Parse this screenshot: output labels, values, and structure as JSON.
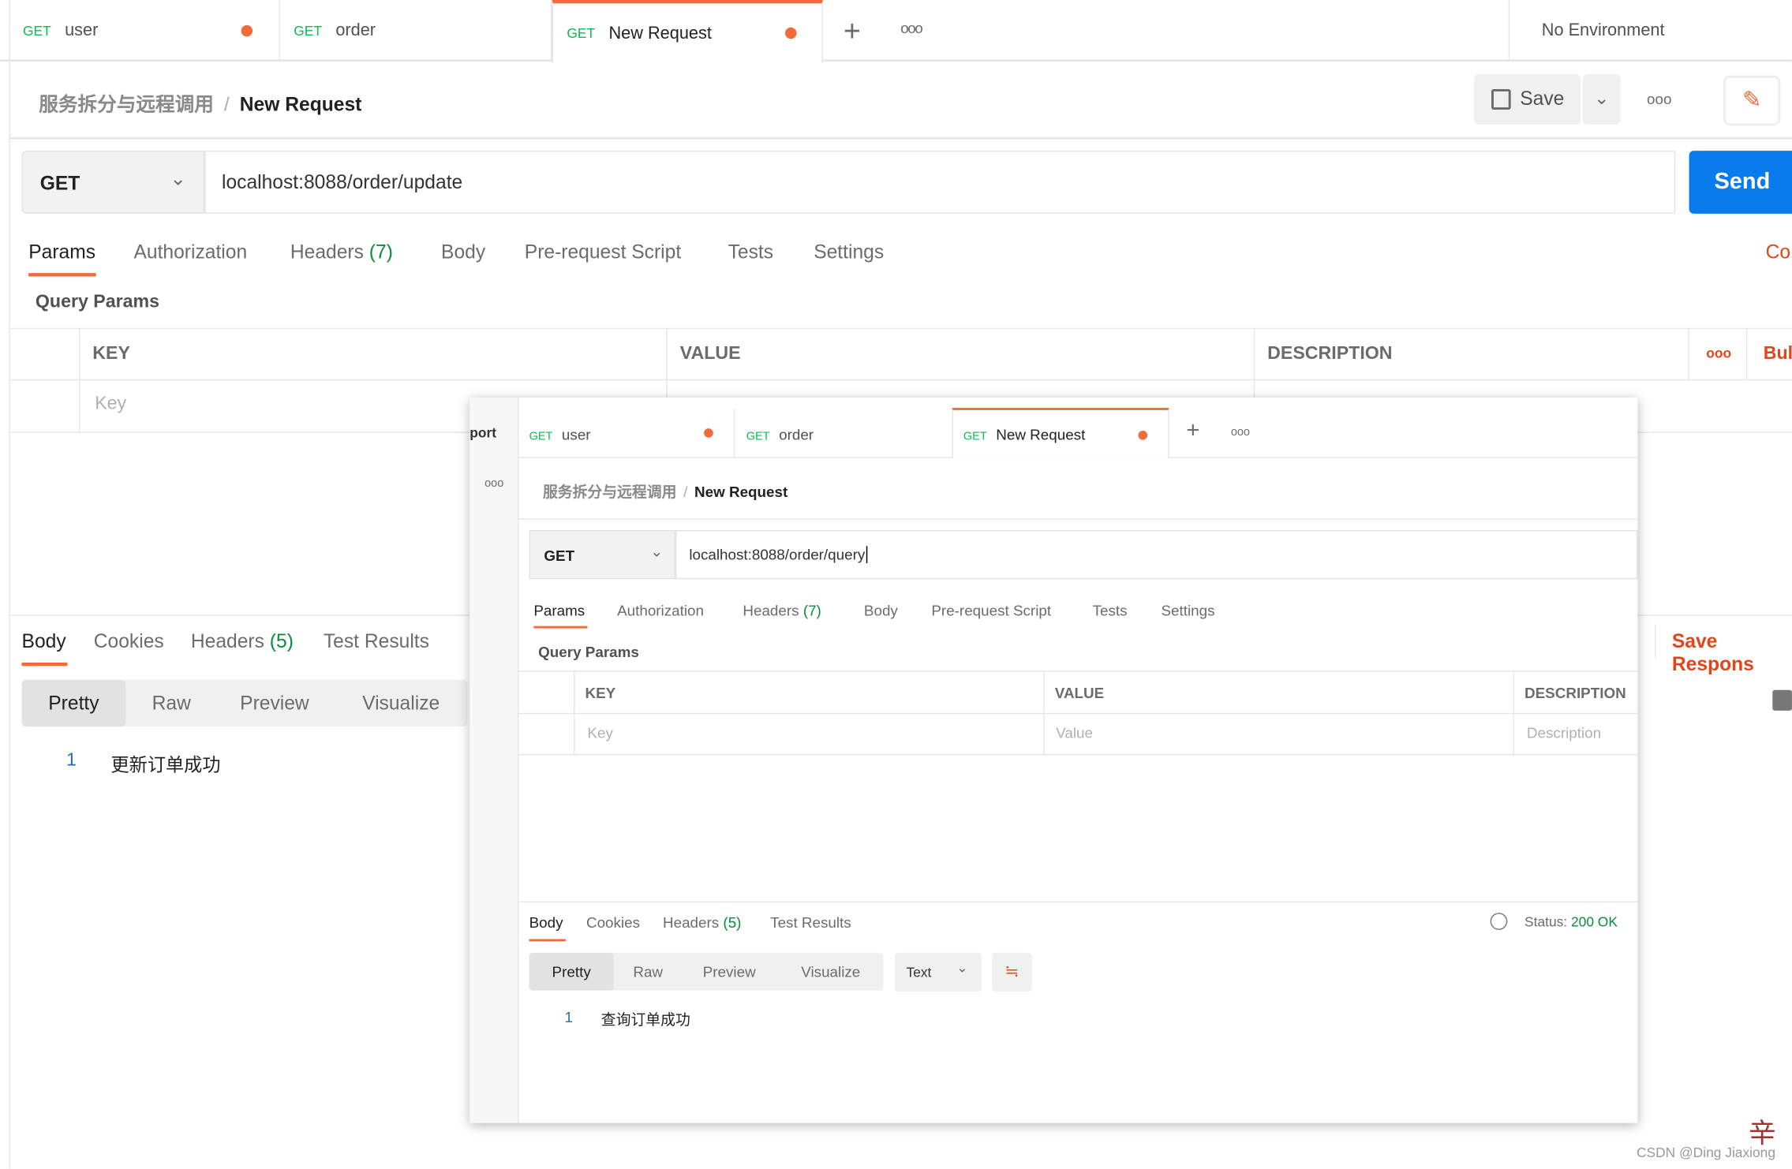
{
  "tabs": [
    {
      "method": "GET",
      "name": "user",
      "unsaved": true
    },
    {
      "method": "GET",
      "name": "order",
      "unsaved": false
    },
    {
      "method": "GET",
      "name": "New Request",
      "unsaved": true,
      "active": true
    }
  ],
  "environment": "No Environment",
  "breadcrumb": {
    "collection": "服务拆分与远程调用",
    "request": "New Request"
  },
  "save_label": "Save",
  "method": "GET",
  "url": "localhost:8088/order/update",
  "send_label": "Send",
  "request_tabs": [
    "Params",
    "Authorization",
    "Headers",
    "Body",
    "Pre-request Script",
    "Tests",
    "Settings"
  ],
  "headers_count": "(7)",
  "cookies_label": "Co",
  "query_params_title": "Query Params",
  "columns": {
    "key": "KEY",
    "value": "VALUE",
    "description": "DESCRIPTION",
    "bulk": "Bul"
  },
  "placeholders": {
    "key": "Key",
    "value": "Value",
    "description": "Description"
  },
  "response_tabs": [
    "Body",
    "Cookies",
    "Headers",
    "Test Results"
  ],
  "response_headers_count": "(5)",
  "view_modes": [
    "Pretty",
    "Raw",
    "Preview",
    "Visualize"
  ],
  "save_response": "Save Respons",
  "response_body": {
    "line": "1",
    "text": "更新订单成功"
  },
  "overlay": {
    "side_label": "port",
    "tabs": [
      {
        "method": "GET",
        "name": "user"
      },
      {
        "method": "GET",
        "name": "order"
      },
      {
        "method": "GET",
        "name": "New Request"
      }
    ],
    "breadcrumb": {
      "collection": "服务拆分与远程调用",
      "request": "New Request"
    },
    "method": "GET",
    "url": "localhost:8088/order/query",
    "request_tabs": [
      "Params",
      "Authorization",
      "Headers",
      "Body",
      "Pre-request Script",
      "Tests",
      "Settings"
    ],
    "headers_count": "(7)",
    "query_params_title": "Query Params",
    "columns": {
      "key": "KEY",
      "value": "VALUE",
      "description": "DESCRIPTION"
    },
    "placeholders": {
      "key": "Key",
      "value": "Value",
      "description": "Description"
    },
    "response_tabs": [
      "Body",
      "Cookies",
      "Headers",
      "Test Results"
    ],
    "response_headers_count": "(5)",
    "status_label": "Status:",
    "status_value": "200 OK",
    "view_modes": [
      "Pretty",
      "Raw",
      "Preview",
      "Visualize"
    ],
    "format": "Text",
    "response_body": {
      "line": "1",
      "text": "查询订单成功"
    }
  },
  "watermark": "CSDN @Ding Jiaxiong",
  "colors": {
    "accent": "#f26b3a",
    "send": "#097bed",
    "green": "#0cbb52",
    "danger": "#e0461a"
  }
}
